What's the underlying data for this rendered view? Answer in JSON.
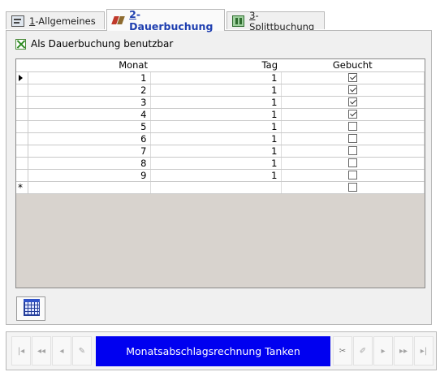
{
  "tabs": [
    {
      "key": "1",
      "label": "-Allgemeines",
      "icon": "properties-icon",
      "active": false
    },
    {
      "key": "2",
      "label": "-Dauerbuchung",
      "icon": "recurring-booking-icon",
      "active": true
    },
    {
      "key": "3",
      "label": "-Splittbuchung",
      "icon": "split-booking-icon",
      "active": false
    }
  ],
  "recurring": {
    "checkbox_label": "Als Dauerbuchung benutzbar",
    "checked": true
  },
  "grid": {
    "columns": [
      "Monat",
      "Tag",
      "Gebucht"
    ],
    "rows": [
      {
        "monat": "1",
        "tag": "1",
        "gebucht": true
      },
      {
        "monat": "2",
        "tag": "1",
        "gebucht": true
      },
      {
        "monat": "3",
        "tag": "1",
        "gebucht": true
      },
      {
        "monat": "4",
        "tag": "1",
        "gebucht": true
      },
      {
        "monat": "5",
        "tag": "1",
        "gebucht": false
      },
      {
        "monat": "6",
        "tag": "1",
        "gebucht": false
      },
      {
        "monat": "7",
        "tag": "1",
        "gebucht": false
      },
      {
        "monat": "8",
        "tag": "1",
        "gebucht": false
      },
      {
        "monat": "9",
        "tag": "1",
        "gebucht": false
      }
    ],
    "new_row_marker": "*"
  },
  "navigator": {
    "record_label": "Monatsabschlagsrechnung Tanken",
    "highlight_color": "#0000f0",
    "buttons": {
      "first": "|◂",
      "prev_page": "◂◂",
      "prev": "◂",
      "new": "✎",
      "delete": "✂",
      "edit": "✐",
      "next": "▸",
      "next_page": "▸▸",
      "last": "▸|"
    }
  }
}
